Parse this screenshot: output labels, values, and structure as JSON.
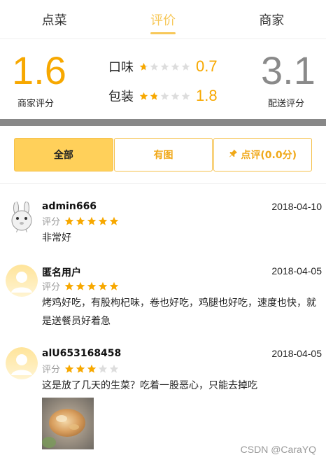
{
  "tabs": [
    {
      "label": "点菜",
      "active": false
    },
    {
      "label": "评价",
      "active": true
    },
    {
      "label": "商家",
      "active": false
    }
  ],
  "summary": {
    "merchant_score": "1.6",
    "merchant_label": "商家评分",
    "delivery_score": "3.1",
    "delivery_label": "配送评分",
    "taste": {
      "label": "口味",
      "value": "0.7",
      "stars": 0.7
    },
    "packaging": {
      "label": "包装",
      "value": "1.8",
      "stars": 1.8
    }
  },
  "filters": {
    "all": "全部",
    "with_pics": "有图",
    "score": "点评(0.0分)"
  },
  "reviews": [
    {
      "user": "admin666",
      "date": "2018-04-10",
      "rating_label": "评分",
      "stars": 5,
      "text": "非常好",
      "avatar": "bunny-avatar"
    },
    {
      "user": "匿名用户",
      "date": "2018-04-05",
      "rating_label": "评分",
      "stars": 5,
      "text": "烤鸡好吃，有股枸杞味，卷也好吃，鸡腿也好吃，速度也快，就是送餐员好着急",
      "avatar": "default-avatar"
    },
    {
      "user": "alU653168458",
      "date": "2018-04-05",
      "rating_label": "评分",
      "stars": 3,
      "text": "这是放了几天的生菜？吃着一股恶心，只能去掉吃",
      "avatar": "default-avatar",
      "has_photo": true
    }
  ],
  "watermark": "CSDN @CaraYQ",
  "colors": {
    "accent": "#f7c85a",
    "score_orange": "#f7a800",
    "star_empty": "#dddddd",
    "star_full": "#f7a800"
  }
}
